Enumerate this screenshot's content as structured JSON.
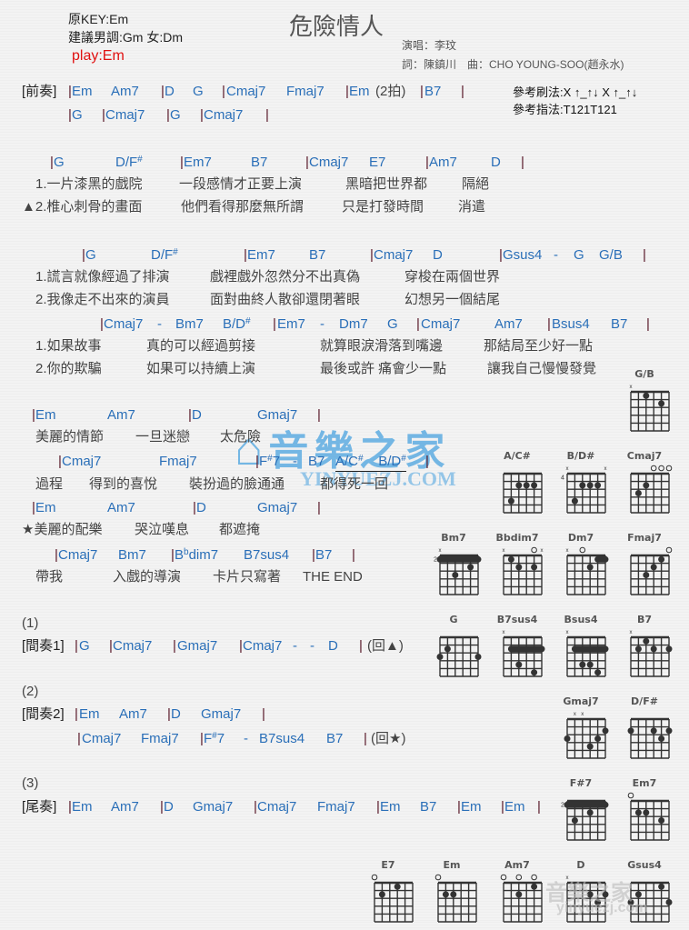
{
  "header": {
    "original_key": "原KEY:Em",
    "suggested_key": "建議男調:Gm 女:Dm",
    "play_key": "play:Em",
    "title": "危險情人",
    "singer": "演唱：李玟",
    "credits": "詞：陳鎮川　曲：CHO YOUNG-SOO(趙永水)",
    "strum_ref": "參考刷法:X ↑_↑↓ X ↑_↑↓",
    "finger_ref": "參考指法:T121T121"
  },
  "intro": {
    "tag": "[前奏]",
    "row1": [
      "Em",
      "Am7",
      "D",
      "G",
      "Cmaj7",
      "Fmaj7",
      "Em",
      "(2拍)",
      "B7"
    ],
    "row2": [
      "G",
      "Cmaj7",
      "G",
      "Cmaj7"
    ]
  },
  "verse1": {
    "chords": [
      "G",
      "D/F",
      "Em7",
      "B7",
      "Cmaj7",
      "E7",
      "Am7",
      "D"
    ],
    "sharp": "#",
    "lyrics1": [
      "1.一片漆黑的戲院",
      "一段感情才正要上演",
      "黑暗把世界都",
      "隔絕"
    ],
    "lyrics2": [
      "▲2.椎心刺骨的畫面",
      "他們看得那麼無所謂",
      "只是打發時間",
      "消遣"
    ]
  },
  "verse2": {
    "chords": [
      "G",
      "D/F",
      "Em7",
      "B7",
      "Cmaj7",
      "D",
      "Gsus4",
      "-",
      "G",
      "G/B"
    ],
    "lyrics1": [
      "1.謊言就像經過了排演",
      "戲裡戲外忽然分不出真偽",
      "穿梭在兩個世界"
    ],
    "lyrics2": [
      "2.我像走不出來的演員",
      "面對曲終人散卻還閉著眼",
      "幻想另一個結尾"
    ]
  },
  "prechorus": {
    "chords": [
      "Cmaj7",
      "-",
      "Bm7",
      "B/D",
      "Em7",
      "-",
      "Dm7",
      "G",
      "Cmaj7",
      "Am7",
      "Bsus4",
      "B7"
    ],
    "lyrics1": [
      "1.如果故事",
      "真的可以經過剪接",
      "就算眼淚滑落到嘴邊",
      "那結局至少好一點"
    ],
    "lyrics2": [
      "2.你的欺騙",
      "如果可以持續上演",
      "最後或許 痛會少一點",
      "讓我自己慢慢發覺"
    ]
  },
  "chorus": {
    "row1_chords": [
      "Em",
      "Am7",
      "D",
      "Gmaj7"
    ],
    "row1_lyrics": [
      "美麗的情節",
      "一旦迷戀",
      "太危險"
    ],
    "row2_chords": [
      "Cmaj7",
      "Fmaj7",
      "F",
      "7",
      "-",
      "B7",
      "A/C",
      "B/D"
    ],
    "row2_lyrics": [
      "過程",
      "得到的喜悅",
      "裝扮過的臉通通",
      "都得死一回"
    ],
    "row3_chords": [
      "Em",
      "Am7",
      "D",
      "Gmaj7"
    ],
    "row3_lyrics": [
      "★美麗的配樂",
      "哭泣嘆息",
      "都遮掩"
    ],
    "row4_chords": [
      "Cmaj7",
      "Bm7",
      "B",
      "b",
      "dim7",
      "B7sus4",
      "B7"
    ],
    "row4_lyrics": [
      "帶我",
      "入戲的導演",
      "卡片只寫著",
      "THE END"
    ]
  },
  "interlude1": {
    "num": "(1)",
    "tag": "[間奏1]",
    "chords": [
      "G",
      "Cmaj7",
      "Gmaj7",
      "Cmaj7",
      "-",
      "-",
      "D"
    ],
    "back": "(回▲)"
  },
  "interlude2": {
    "num": "(2)",
    "tag": "[間奏2]",
    "row1": [
      "Em",
      "Am7",
      "D",
      "Gmaj7"
    ],
    "row2": [
      "Cmaj7",
      "Fmaj7",
      "F",
      "7",
      "-",
      "B7sus4",
      "B7"
    ],
    "back": "(回★)"
  },
  "outro": {
    "num": "(3)",
    "tag": "[尾奏]",
    "chords": [
      "Em",
      "Am7",
      "D",
      "Gmaj7",
      "Cmaj7",
      "Fmaj7",
      "Em",
      "B7",
      "Em",
      "Em"
    ]
  },
  "watermark": {
    "main": "音樂之家",
    "sub": "YINYUEZJ.COM",
    "corner": "yinyuezj.com"
  },
  "diagrams": [
    {
      "name": "G/B",
      "marks": "x.....",
      "fret": "",
      "barre": null,
      "dots": [
        [
          2,
          1
        ],
        [
          4,
          2
        ]
      ]
    },
    {
      "name": "A/C#",
      "marks": "......",
      "fret": "",
      "barre": null,
      "dots": [
        [
          2,
          2
        ],
        [
          3,
          2
        ],
        [
          4,
          2
        ],
        [
          1,
          4
        ]
      ]
    },
    {
      "name": "B/D#",
      "marks": "x....x",
      "fret": "4",
      "barre": null,
      "dots": [
        [
          2,
          2
        ],
        [
          3,
          2
        ],
        [
          4,
          2
        ],
        [
          1,
          4
        ]
      ]
    },
    {
      "name": "Cmaj7",
      "marks": "...ooo",
      "fret": "",
      "barre": null,
      "dots": [
        [
          2,
          2
        ],
        [
          1,
          3
        ]
      ]
    },
    {
      "name": "Bm7",
      "marks": "x.....",
      "fret": "2",
      "barre": [
        1,
        0,
        5
      ],
      "dots": [
        [
          4,
          2
        ],
        [
          2,
          3
        ]
      ]
    },
    {
      "name": "Bbdim7",
      "marks": "x...ox",
      "fret": "",
      "barre": null,
      "dots": [
        [
          1,
          1
        ],
        [
          2,
          2
        ],
        [
          4,
          2
        ]
      ]
    },
    {
      "name": "Dm7",
      "marks": "x.o...",
      "fret": "",
      "barre": [
        1,
        4,
        5
      ],
      "dots": [
        [
          3,
          2
        ]
      ]
    },
    {
      "name": "Fmaj7",
      "marks": ".....o",
      "fret": "",
      "barre": null,
      "dots": [
        [
          4,
          1
        ],
        [
          3,
          2
        ],
        [
          2,
          3
        ]
      ]
    },
    {
      "name": "G",
      "marks": "......",
      "fret": "",
      "barre": null,
      "dots": [
        [
          1,
          2
        ],
        [
          0,
          3
        ],
        [
          5,
          3
        ]
      ]
    },
    {
      "name": "B7sus4",
      "marks": "x.....",
      "fret": "",
      "barre": [
        2,
        1,
        5
      ],
      "dots": [
        [
          2,
          4
        ],
        [
          4,
          5
        ]
      ]
    },
    {
      "name": "Bsus4",
      "marks": "x.....",
      "fret": "",
      "barre": [
        2,
        1,
        5
      ],
      "dots": [
        [
          2,
          4
        ],
        [
          3,
          4
        ],
        [
          4,
          5
        ]
      ]
    },
    {
      "name": "B7",
      "marks": "x.....",
      "fret": "",
      "barre": null,
      "dots": [
        [
          2,
          1
        ],
        [
          1,
          2
        ],
        [
          3,
          2
        ],
        [
          5,
          2
        ]
      ]
    },
    {
      "name": "Gmaj7",
      "marks": ".xx...",
      "fret": "",
      "barre": null,
      "dots": [
        [
          5,
          2
        ],
        [
          0,
          3
        ],
        [
          4,
          3
        ],
        [
          3,
          4
        ]
      ]
    },
    {
      "name": "D/F#",
      "marks": "......",
      "fret": "",
      "barre": null,
      "dots": [
        [
          0,
          2
        ],
        [
          3,
          2
        ],
        [
          5,
          2
        ],
        [
          4,
          3
        ]
      ]
    },
    {
      "name": "F#7",
      "marks": "......",
      "fret": "2",
      "barre": [
        1,
        0,
        5
      ],
      "dots": [
        [
          3,
          2
        ],
        [
          1,
          3
        ]
      ]
    },
    {
      "name": "Em7",
      "marks": "o.....",
      "fret": "",
      "barre": null,
      "dots": [
        [
          1,
          2
        ],
        [
          2,
          2
        ],
        [
          4,
          3
        ]
      ]
    },
    {
      "name": "E7",
      "marks": "o.....",
      "fret": "",
      "barre": null,
      "dots": [
        [
          3,
          1
        ],
        [
          1,
          2
        ]
      ]
    },
    {
      "name": "Em",
      "marks": "o.....",
      "fret": "",
      "barre": null,
      "dots": [
        [
          1,
          2
        ],
        [
          2,
          2
        ]
      ]
    },
    {
      "name": "Am7",
      "marks": "o.o.o.",
      "fret": "",
      "barre": null,
      "dots": [
        [
          4,
          1
        ],
        [
          2,
          2
        ]
      ]
    },
    {
      "name": "D",
      "marks": "x.....",
      "fret": "",
      "barre": null,
      "dots": [
        [
          3,
          2
        ],
        [
          5,
          2
        ],
        [
          4,
          3
        ]
      ]
    },
    {
      "name": "Gsus4",
      "marks": "......",
      "fret": "",
      "barre": null,
      "dots": [
        [
          4,
          1
        ],
        [
          1,
          2
        ],
        [
          0,
          3
        ],
        [
          5,
          3
        ]
      ]
    }
  ]
}
